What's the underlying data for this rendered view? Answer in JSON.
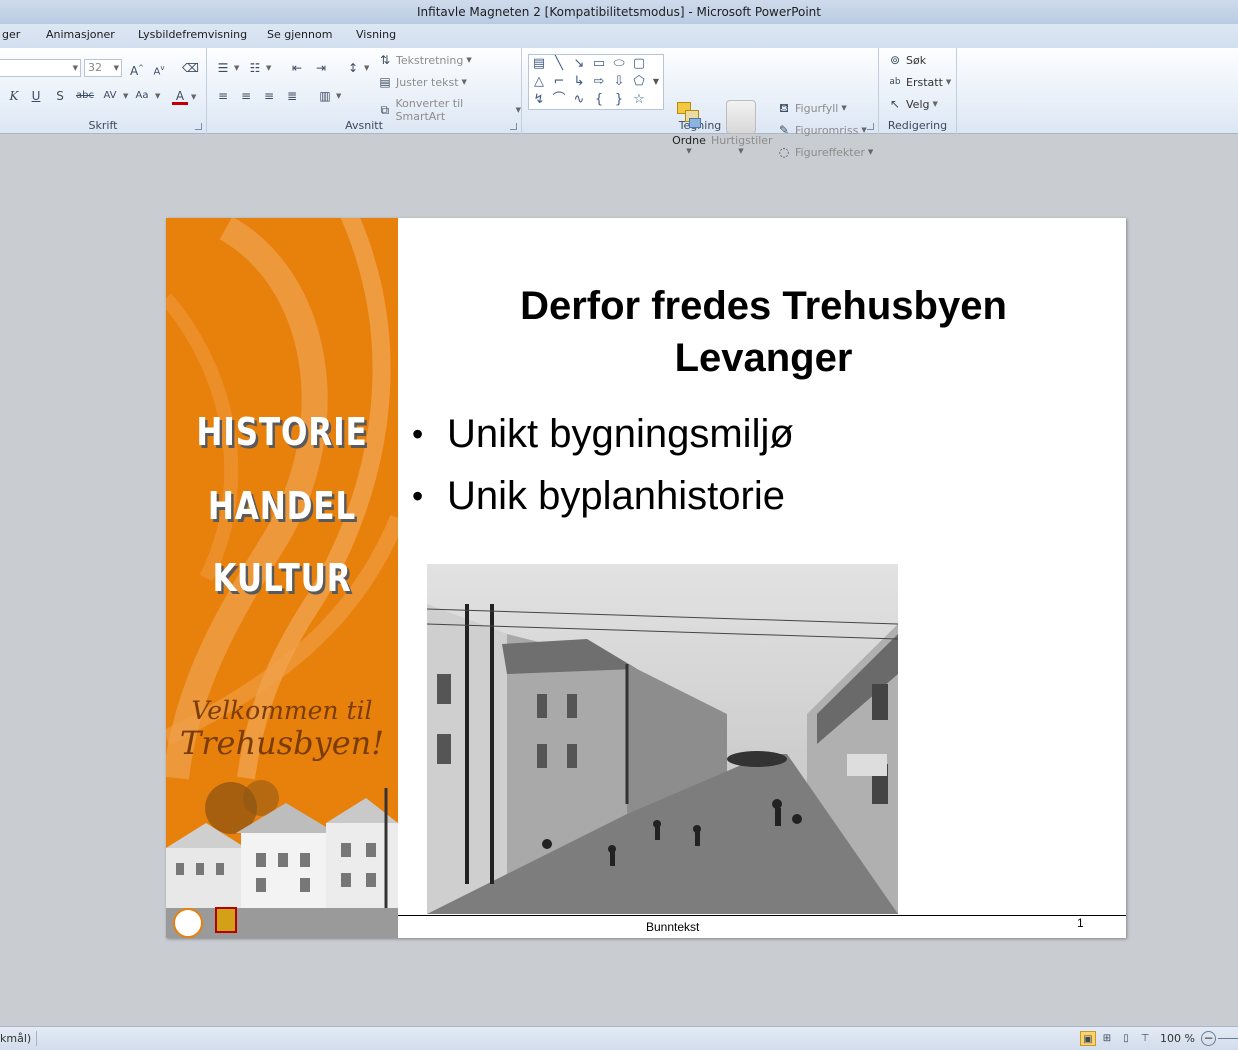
{
  "window": {
    "title": "Infitavle Magneten 2 [Kompatibilitetsmodus]  -  Microsoft PowerPoint"
  },
  "tabs": [
    "ger",
    "Animasjoner",
    "Lysbildefremvisning",
    "Se gjennom",
    "Visning"
  ],
  "ribbon": {
    "font_group": {
      "label": "Skrift",
      "size_value": "32",
      "grow_icon": "font-grow-icon",
      "shrink_icon": "font-shrink-icon"
    },
    "paragraph_group": {
      "label": "Avsnitt",
      "text_direction": "Tekstretning",
      "align_text": "Juster tekst",
      "convert_smartart": "Konverter til SmartArt"
    },
    "drawing_group": {
      "label": "Tegning",
      "arrange": "Ordne",
      "quick_styles": "Hurtigstiler",
      "shape_fill": "Figurfyll",
      "shape_outline": "Figuromriss",
      "shape_effects": "Figureffekter"
    },
    "editing_group": {
      "label": "Redigering",
      "find": "Søk",
      "replace": "Erstatt",
      "select": "Velg"
    }
  },
  "slide": {
    "banner": {
      "words": [
        "HISTORIE",
        "HANDEL",
        "KULTUR"
      ],
      "welcome_line1": "Velkommen til",
      "welcome_line2": "Trehusbyen!",
      "color": "#e8810c"
    },
    "title_line1": "Derfor fredes Trehusbyen",
    "title_line2": "Levanger",
    "bullets": [
      "Unikt bygningsmiljø",
      "Unik byplanhistorie"
    ],
    "footer": "Bunntekst",
    "page_number": "1"
  },
  "statusbar": {
    "language": "kmål)",
    "zoom": "100 %",
    "zoom_out": "−"
  }
}
